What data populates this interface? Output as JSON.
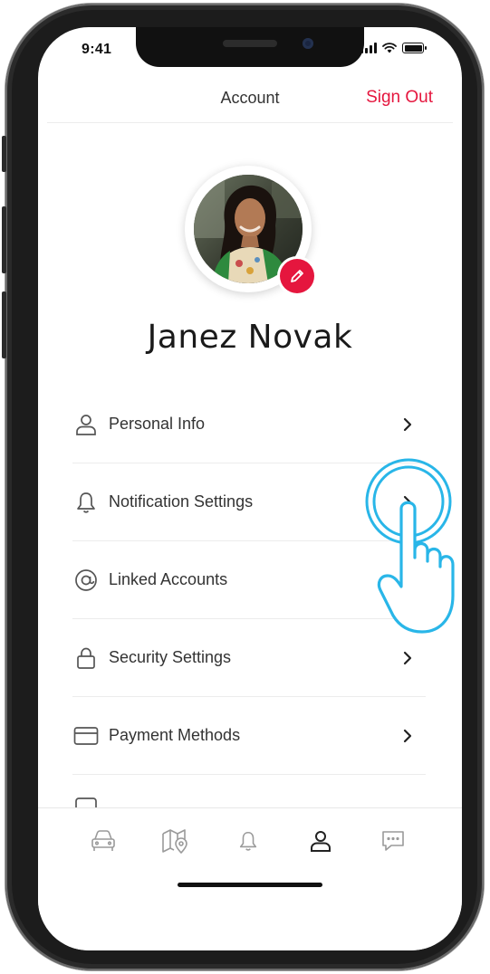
{
  "status_bar": {
    "time": "9:41"
  },
  "header": {
    "title": "Account",
    "sign_out_label": "Sign Out"
  },
  "profile": {
    "name": "Janez Novak",
    "avatar_icon": "user-photo",
    "edit_icon": "pencil-icon"
  },
  "menu": {
    "items": [
      {
        "label": "Personal Info",
        "icon": "person-icon",
        "has_chevron": true
      },
      {
        "label": "Notification Settings",
        "icon": "bell-icon",
        "has_chevron": true
      },
      {
        "label": "Linked Accounts",
        "icon": "at-sign-icon",
        "has_chevron": false
      },
      {
        "label": "Security Settings",
        "icon": "lock-icon",
        "has_chevron": true
      },
      {
        "label": "Payment Methods",
        "icon": "credit-card-icon",
        "has_chevron": true
      }
    ]
  },
  "tab_bar": {
    "tabs": [
      {
        "icon": "car-icon",
        "active": false
      },
      {
        "icon": "map-pin-icon",
        "active": false
      },
      {
        "icon": "bell-icon",
        "active": false
      },
      {
        "icon": "person-icon",
        "active": true
      },
      {
        "icon": "chat-icon",
        "active": false
      }
    ]
  },
  "colors": {
    "accent": "#e5163e",
    "tap_hint": "#29b6e8",
    "text": "#333333",
    "inactive_icon": "#9a9a9a"
  }
}
